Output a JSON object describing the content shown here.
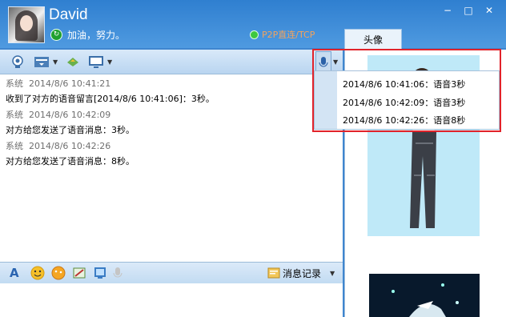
{
  "user": {
    "name": "David",
    "signature": "加油，努力。"
  },
  "connection": {
    "status": "P2P直连/TCP"
  },
  "window_controls": {
    "minimize": "−",
    "maximize": "□",
    "close": "✕"
  },
  "side_panel": {
    "tab_label": "头像"
  },
  "messages": [
    {
      "sender": "系统",
      "time": "2014/8/6 10:41:21",
      "text": "收到了对方的语音留言[2014/8/6 10:41:06]：3秒。"
    },
    {
      "sender": "系统",
      "time": "2014/8/6 10:42:09",
      "text": "对方给您发送了语音消息：3秒。"
    },
    {
      "sender": "系统",
      "time": "2014/8/6 10:42:26",
      "text": "对方给您发送了语音消息：8秒。"
    }
  ],
  "voice_menu": [
    {
      "label": "2014/8/6 10:41:06：语音3秒"
    },
    {
      "label": "2014/8/6 10:42:09：语音3秒"
    },
    {
      "label": "2014/8/6 10:42:26：语音8秒"
    }
  ],
  "input_toolbar": {
    "history_label": "消息记录"
  },
  "icons": {
    "toolbar": [
      "camera-icon",
      "file-transfer-icon",
      "app-icon",
      "screen-share-icon",
      "voice-message-icon"
    ],
    "input": [
      "font-icon",
      "emoji-icon",
      "gif-icon",
      "screenshot-icon",
      "picture-icon",
      "voice-icon",
      "history-icon"
    ]
  },
  "colors": {
    "title_bar": "#2f7fd0",
    "highlight_border": "#e1232b",
    "connection_text": "#f3a35d"
  }
}
